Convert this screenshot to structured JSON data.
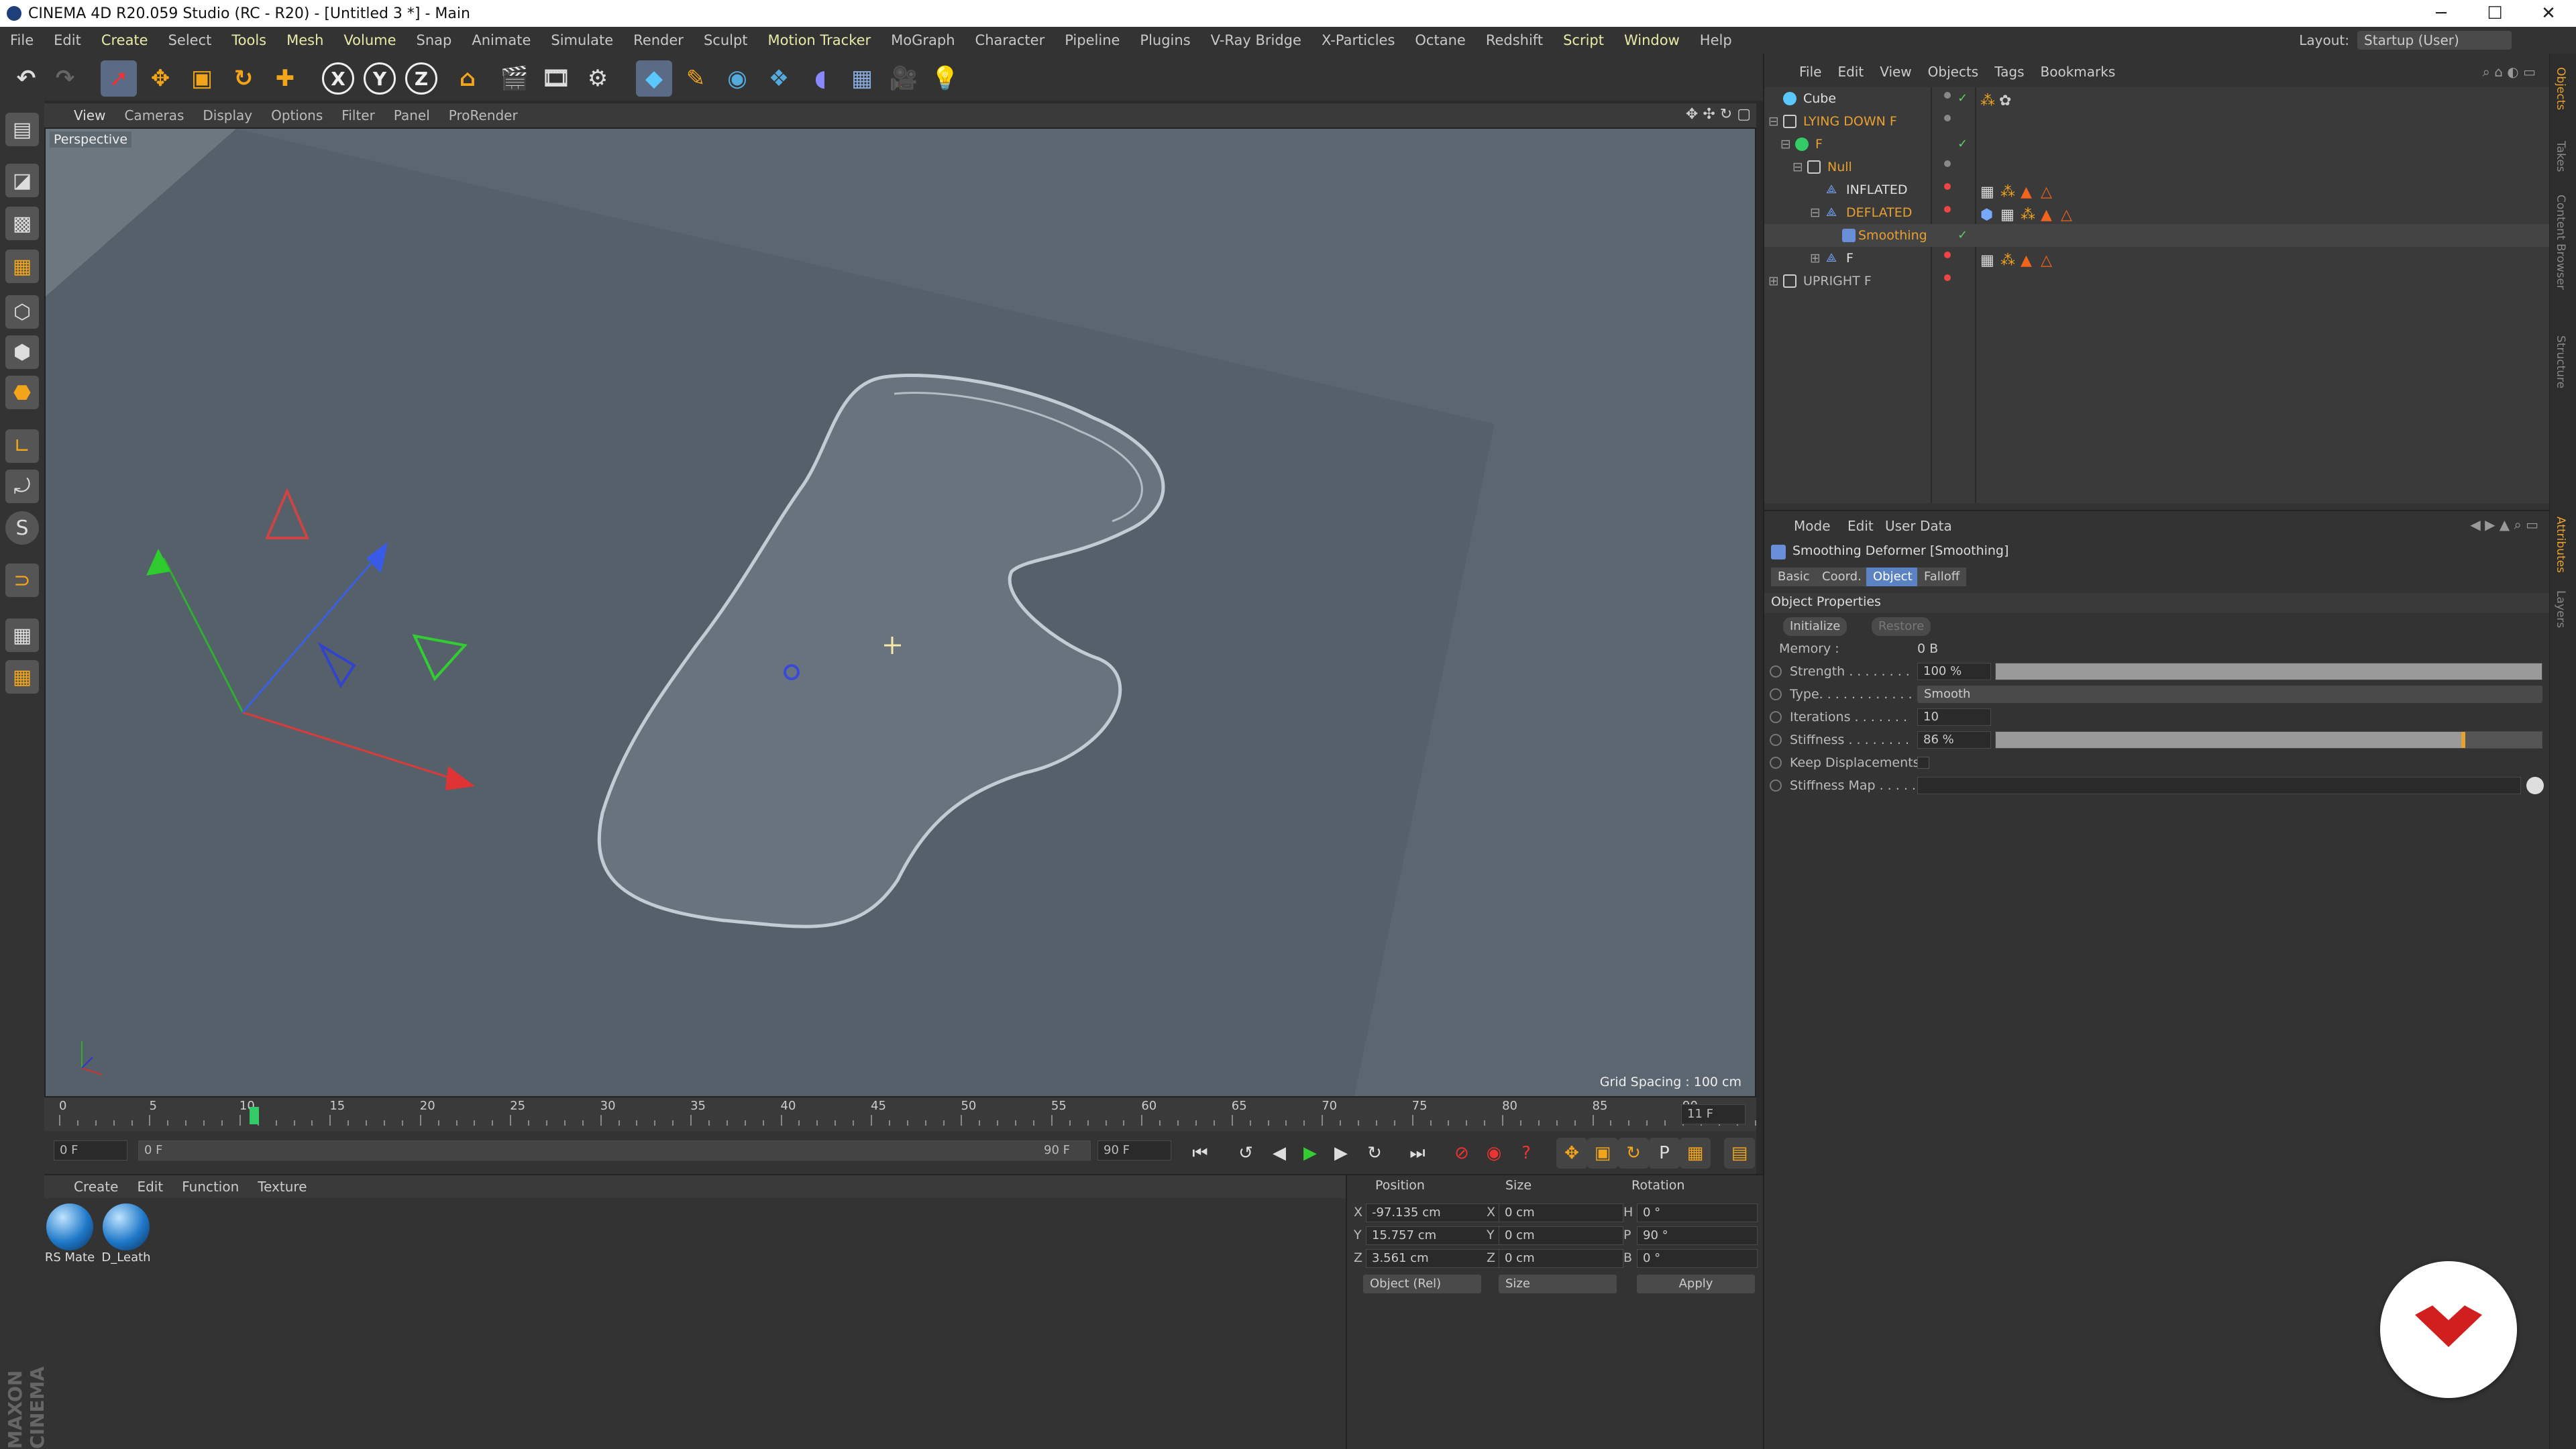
{
  "window": {
    "title": "CINEMA 4D R20.059 Studio (RC - R20) - [Untitled 3 *] - Main",
    "controls": [
      "─",
      "☐",
      "✕"
    ]
  },
  "menu": [
    "File",
    "Edit",
    "Create",
    "Select",
    "Tools",
    "Mesh",
    "Volume",
    "Snap",
    "Animate",
    "Simulate",
    "Render",
    "Sculpt",
    "Motion Tracker",
    "MoGraph",
    "Character",
    "Pipeline",
    "Plugins",
    "V-Ray Bridge",
    "X-Particles",
    "Octane",
    "Redshift",
    "Script",
    "Window",
    "Help"
  ],
  "layout": {
    "label": "Layout:",
    "value": "Startup (User)"
  },
  "toolbar": {
    "x_label": "X",
    "y_label": "Y",
    "z_label": "Z"
  },
  "viewport": {
    "menu": [
      "View",
      "Cameras",
      "Display",
      "Options",
      "Filter",
      "Panel",
      "ProRender"
    ],
    "camera_label": "Perspective",
    "grid_spacing": "Grid Spacing : 100 cm"
  },
  "timeline": {
    "ticks": [
      "0",
      "5",
      "10",
      "15",
      "20",
      "25",
      "30",
      "35",
      "40",
      "45",
      "50",
      "55",
      "60",
      "65",
      "70",
      "75",
      "80",
      "85",
      "90"
    ],
    "current_frame": "11 F",
    "start_field": "0 F",
    "range_start": "0 F",
    "range_end": "90 F",
    "end_field": "90 F"
  },
  "materials": {
    "menu": [
      "Create",
      "Edit",
      "Function",
      "Texture"
    ],
    "items": [
      "RS Mate",
      "D_Leath"
    ]
  },
  "coords": {
    "headers": {
      "position": "Position",
      "size": "Size",
      "rotation": "Rotation"
    },
    "axes": [
      "X",
      "Y",
      "Z"
    ],
    "position": [
      "-97.135 cm",
      "15.757 cm",
      "3.561 cm"
    ],
    "size_axes": [
      "X",
      "Y",
      "Z"
    ],
    "size": [
      "0 cm",
      "0 cm",
      "0 cm"
    ],
    "rot_axes": [
      "H",
      "P",
      "B"
    ],
    "rotation": [
      "0 °",
      "90 °",
      "0 °"
    ],
    "mode_select": "Object (Rel)",
    "size_select": "Size",
    "apply": "Apply"
  },
  "objects": {
    "menu": [
      "File",
      "Edit",
      "View",
      "Objects",
      "Tags",
      "Bookmarks"
    ],
    "rows": [
      {
        "name": "Cube",
        "indent": 0
      },
      {
        "name": "LYING DOWN F",
        "indent": 0
      },
      {
        "name": "F",
        "indent": 1
      },
      {
        "name": "Null",
        "indent": 2
      },
      {
        "name": "INFLATED",
        "indent": 3
      },
      {
        "name": "DEFLATED",
        "indent": 3
      },
      {
        "name": "Smoothing",
        "indent": 4
      },
      {
        "name": "F",
        "indent": 3
      },
      {
        "name": "UPRIGHT F",
        "indent": 0
      }
    ]
  },
  "attributes": {
    "menu": [
      "Mode",
      "Edit",
      "User Data"
    ],
    "title": "Smoothing Deformer [Smoothing]",
    "tabs": [
      "Basic",
      "Coord.",
      "Object",
      "Falloff"
    ],
    "active_tab": "Object",
    "section": "Object Properties",
    "initialize": "Initialize",
    "restore": "Restore",
    "memory_label": "Memory :",
    "memory_value": "0 B",
    "strength_label": "Strength . . . . . . . .",
    "strength_value": "100 %",
    "strength_level": 1.0,
    "type_label": "Type. . . . . . . . . . . .",
    "type_value": "Smooth",
    "iterations_label": "Iterations . . . . . . .",
    "iterations_value": "10",
    "stiffness_label": "Stiffness . . . . . . . .",
    "stiffness_value": "86 %",
    "stiffness_level": 0.86,
    "keep_label": "Keep Displacements",
    "stiffmap_label": "Stiffness Map . . . . ."
  },
  "right_tabs": [
    "Objects",
    "Takes",
    "Content Browser",
    "Structure",
    "Attributes",
    "Layers"
  ],
  "branding": "MAXON CINEMA 4D",
  "colors": {
    "accent_blue": "#5b82c2",
    "object_orange": "#e8a030",
    "active_green": "#6c6"
  }
}
